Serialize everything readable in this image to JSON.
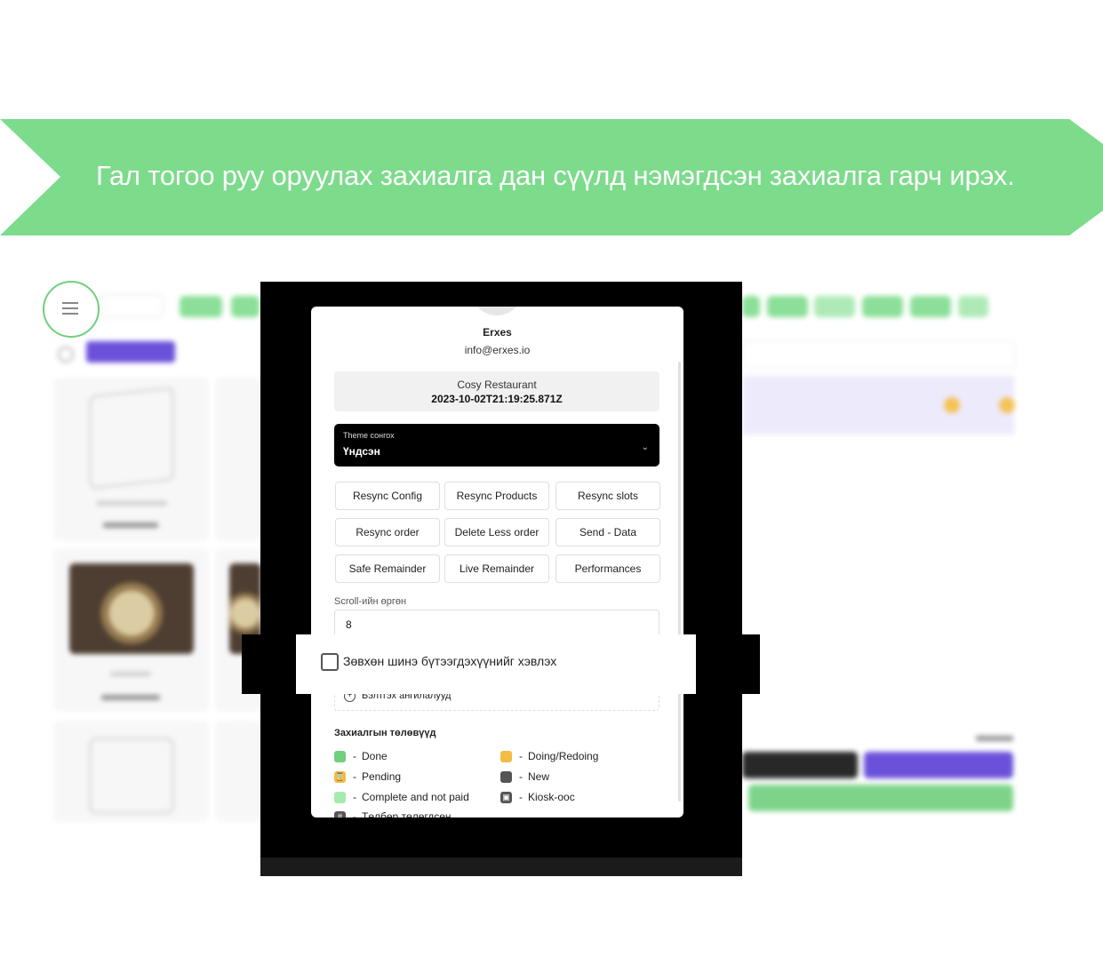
{
  "banner": {
    "text": "Гал тогоо руу оруулах захиалга дан сүүлд нэмэгдсэн захиалга гарч ирэх.",
    "color": "#7ddb8c"
  },
  "profile": {
    "name": "Erxes",
    "email": "info@erxes.io"
  },
  "restaurant": {
    "name": "Cosy Restaurant",
    "timestamp": "2023-10-02T21:19:25.871Z"
  },
  "theme": {
    "label": "Theme сонгох",
    "value": "Үндсэн"
  },
  "buttons": {
    "resync_config": "Resync Config",
    "resync_products": "Resync Products",
    "resync_slots": "Resync slots",
    "resync_order": "Resync order",
    "delete_less_order": "Delete Less order",
    "send_data": "Send - Data",
    "safe_remainder": "Safe Remainder",
    "live_remainder": "Live Remainder",
    "performances": "Performances"
  },
  "scroll": {
    "label": "Scroll-ийн өргөн",
    "value": "8"
  },
  "checkbox": {
    "label": "Зөвхөн шинэ бүтээгдэхүүнийг хэвлэх",
    "checked": false
  },
  "categories": {
    "label": "Бэлтгэх ангилалууд"
  },
  "statuses": {
    "title": "Захиалгын төлөвүүд",
    "items": [
      {
        "label": "Done",
        "color": "#6fd07d"
      },
      {
        "label": "Doing/Redoing",
        "color": "#f3bd44"
      },
      {
        "label": "Pending",
        "color": "#f3bd44"
      },
      {
        "label": "New",
        "color": "#555555"
      },
      {
        "label": "Complete and not paid",
        "color": "#a7eab1"
      },
      {
        "label": "Kiosk-оос",
        "color": "#555555"
      },
      {
        "label": "Төлбөр төлөгдсөн",
        "color": "#555555"
      }
    ]
  }
}
